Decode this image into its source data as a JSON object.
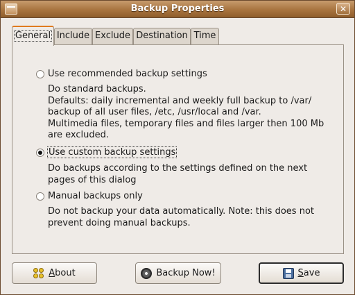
{
  "window": {
    "title": "Backup Properties",
    "close_glyph": "✕"
  },
  "tabs": [
    {
      "label": "General",
      "active": true
    },
    {
      "label": "Include",
      "active": false
    },
    {
      "label": "Exclude",
      "active": false
    },
    {
      "label": "Destination",
      "active": false
    },
    {
      "label": "Time",
      "active": false
    }
  ],
  "options": [
    {
      "label": "Use recommended backup settings",
      "selected": false,
      "description_lines": [
        "Do standard backups.",
        "Defaults: daily incremental and weekly full backup to /var/",
        "backup of all user files, /etc, /usr/local and /var.",
        "Multimedia files, temporary files and files larger then 100 Mb",
        "are excluded."
      ]
    },
    {
      "label": "Use custom backup settings",
      "selected": true,
      "description_lines": [
        "Do backups according to the settings defined on the next",
        "pages of this dialog"
      ]
    },
    {
      "label": "Manual backups only",
      "selected": false,
      "description_lines": [
        "Do not backup your data automatically. Note: this does not",
        "prevent doing manual backups."
      ]
    }
  ],
  "buttons": {
    "about": {
      "mnemonic": "A",
      "rest": "bout",
      "icon": "about-icon"
    },
    "backup_now": {
      "label": "Backup Now!",
      "icon": "gear-icon"
    },
    "save": {
      "mnemonic": "S",
      "rest": "ave",
      "icon": "floppy-disk-icon"
    }
  }
}
